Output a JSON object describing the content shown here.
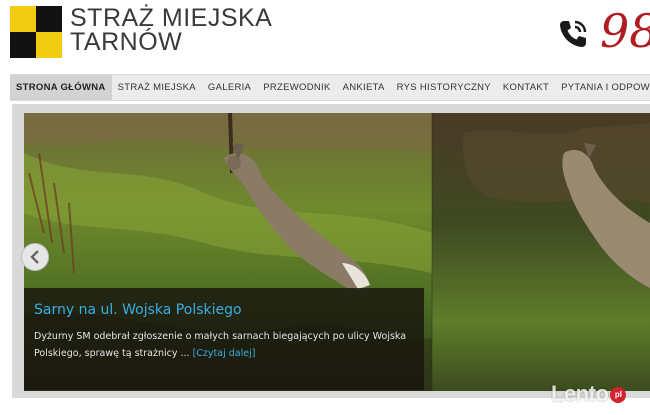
{
  "header": {
    "title_line1": "STRAŻ MIEJSKA",
    "title_line2": "TARNÓW",
    "phone_icon": "phone-icon",
    "phone_number": "98",
    "colors": {
      "logo_yellow": "#f2cc12",
      "logo_black": "#111111",
      "phone_red": "#b01c22"
    }
  },
  "nav": {
    "items": [
      {
        "label": "STRONA GŁÓWNA",
        "active": true
      },
      {
        "label": "STRAŻ MIEJSKA"
      },
      {
        "label": "GALERIA"
      },
      {
        "label": "PRZEWODNIK"
      },
      {
        "label": "ANKIETA"
      },
      {
        "label": "RYS HISTORYCZNY"
      },
      {
        "label": "KONTAKT"
      },
      {
        "label": "PYTANIA I ODPOWIEDZI"
      }
    ]
  },
  "slider": {
    "prev_icon": "chevron-left-icon",
    "caption_title": "Sarny na ul. Wojska Polskiego",
    "caption_text": "Dyżurny SM odebrał zgłoszenie o małych sarnach biegających po ulicy Wojska Polskiego, sprawę tą strażnicy ...",
    "read_more": "[Czytaj dalej]",
    "accent": "#39aee3"
  },
  "watermark": {
    "text": "Lento",
    "badge": "pl"
  }
}
